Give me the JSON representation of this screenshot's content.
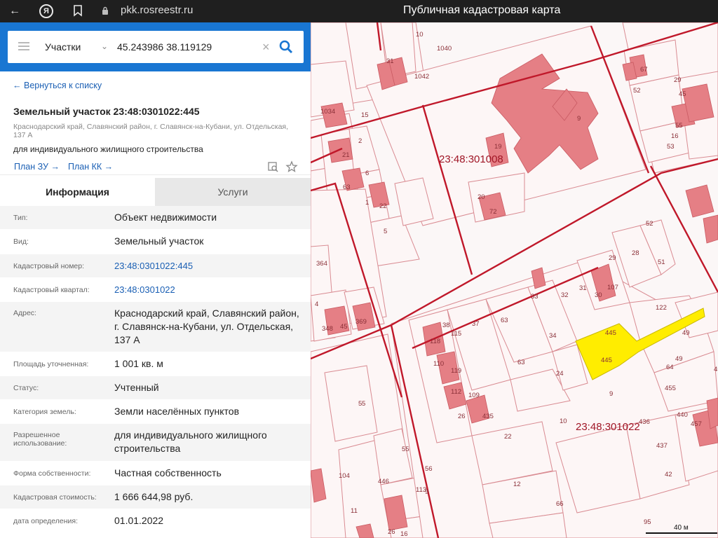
{
  "browser": {
    "url": "pkk.rosreestr.ru",
    "title": "Публичная кадастровая карта",
    "back_icon": "arrow-left-icon",
    "yandex_icon_label": "Я",
    "favorite_icon": "bookmark-icon"
  },
  "search": {
    "type": "Участки",
    "query": "45.243986 38.119129",
    "clear": "×",
    "icon": "search-icon"
  },
  "card": {
    "back_link": "Вернуться к списку",
    "title": "Земельный участок 23:48:0301022:445",
    "address_short": "Краснодарский край, Славянский район, г. Славянск-на-Кубани, ул. Отдельская, 137 А",
    "purpose": "для индивидуального жилищного строительства",
    "plan_zu": "План ЗУ",
    "plan_kk": "План КК"
  },
  "tabs": {
    "info": "Информация",
    "services": "Услуги"
  },
  "props": [
    {
      "label": "Тип:",
      "value": "Объект недвижимости"
    },
    {
      "label": "Вид:",
      "value": "Земельный участок"
    },
    {
      "label": "Кадастровый номер:",
      "value": "23:48:0301022:445",
      "link": true
    },
    {
      "label": "Кадастровый квартал:",
      "value": "23:48:0301022",
      "link": true
    },
    {
      "label": "Адрес:",
      "value": "Краснодарский край, Славянский район, г. Славянск-на-Кубани, ул. Отдельская, 137 А"
    },
    {
      "label": "Площадь уточненная:",
      "value": "1 001 кв. м"
    },
    {
      "label": "Статус:",
      "value": "Учтенный"
    },
    {
      "label": "Категория земель:",
      "value": "Земли населённых пунктов"
    },
    {
      "label": "Разрешенное использование:",
      "value": "для индивидуального жилищного строительства"
    },
    {
      "label": "Форма собственности:",
      "value": "Частная собственность"
    },
    {
      "label": "Кадастровая стоимость:",
      "value": "1 666 644,98 руб."
    },
    {
      "label": "дата определения:",
      "value": "01.01.2022"
    }
  ],
  "map": {
    "quarter_1": "23:48:301008",
    "quarter_2": "23:48:301022",
    "selected_label": "445",
    "scale": "40 м",
    "parcel_labels": [
      "10",
      "31",
      "1042",
      "1040",
      "67",
      "52",
      "29",
      "45",
      "16",
      "15",
      "1034",
      "9",
      "53",
      "55",
      "19",
      "2",
      "21",
      "23:48:301008",
      "6",
      "63",
      "20",
      "72",
      "1",
      "22",
      "5",
      "364",
      "4",
      "45",
      "348",
      "369",
      "52",
      "29",
      "28",
      "51",
      "107",
      "31",
      "30",
      "32",
      "33",
      "122",
      "63",
      "37",
      "38",
      "115",
      "118",
      "110",
      "119",
      "112",
      "109",
      "34",
      "63",
      "445",
      "445",
      "49",
      "49",
      "64",
      "452",
      "24",
      "9",
      "26",
      "435",
      "10",
      "436",
      "440",
      "457",
      "437",
      "455",
      "22",
      "55",
      "5",
      "5",
      "56",
      "113",
      "9",
      "446",
      "12",
      "16",
      "26",
      "11",
      "42",
      "66",
      "104",
      "95"
    ],
    "colors": {
      "boundary": "#c0182a",
      "parcel_line": "#d98b92",
      "building": "#e57f85",
      "selected": "#ffed00"
    }
  }
}
